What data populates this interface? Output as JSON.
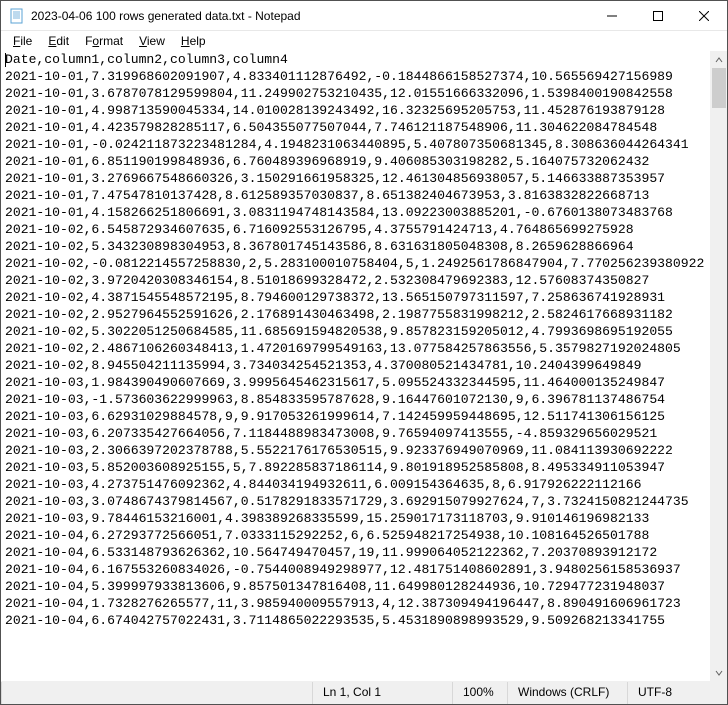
{
  "title": "2023-04-06 100 rows generated data.txt - Notepad",
  "menu": {
    "file": "File",
    "edit": "Edit",
    "format": "Format",
    "view": "View",
    "help": "Help"
  },
  "columns_header": "Date,column1,column2,column3,column4",
  "rows": [
    "2021-10-01,7.319968602091907,4.833401112876492,-0.1844866158527374,10.565569427156989",
    "2021-10-01,3.6787078129599804,11.249902753210435,12.01551666332096,1.5398400190842558",
    "2021-10-01,4.998713590045334,14.010028139243492,16.32325695205753,11.452876193879128",
    "2021-10-01,4.423579828285117,6.504355077507044,7.746121187548906,11.304622084784548",
    "2021-10-01,-0.024211873223481284,4.1948231063440895,5.407807350681345,8.308636044264341",
    "2021-10-01,6.851190199848936,6.760489396968919,9.406085303198282,5.164075732062432",
    "2021-10-01,3.2769667548660326,3.150291661958325,12.461304856938057,5.146633887353957",
    "2021-10-01,7.47547810137428,8.612589357030837,8.651382404673953,3.8163832822668713",
    "2021-10-01,4.158266251806691,3.0831194748143584,13.09223003885201,-0.6760138073483768",
    "2021-10-02,6.545872934607635,6.716092553126795,4.3755791424713,4.764865699275928",
    "2021-10-02,5.343230898304953,8.367801745143586,8.631631805048308,8.2659628866964",
    "2021-10-02,-0.0812214557258830,2,5.283100010758404,5,1.2492561786847904,7.770256239380922",
    "2021-10-02,3.9720420308346154,8.51018699328472,2.532308479692383,12.57608374350827",
    "2021-10-02,4.3871545548572195,8.794600129738372,13.565150797311597,7.258636741928931",
    "2021-10-02,2.9527964552591626,2.176891430463498,2.1987755831998212,2.5824617668931182",
    "2021-10-02,5.3022051250684585,11.685691594820538,9.857823159205012,4.7993698695192055",
    "2021-10-02,2.4867106260348413,1.4720169799549163,13.077584257863556,5.3579827192024805",
    "2021-10-02,8.945504211135994,3.734034254521353,4.370080521434781,10.2404399649849",
    "2021-10-03,1.984390490607669,3.9995645462315617,5.095524332344595,11.464000135249847",
    "2021-10-03,-1.573603622999963,8.854833595787628,9.16447601072130,9,6.396781137486754",
    "2021-10-03,6.62931029884578,9,9.917053261999614,7.142459959448695,12.511741306156125",
    "2021-10-03,6.207335427664056,7.1184488983473008,9.76594097413555,-4.859329656029521",
    "2021-10-03,2.3066397202378788,5.5522176176530515,9.923376949070969,11.084113930692222",
    "2021-10-03,5.852003608925155,5,7.892285837186114,9.801918952585808,8.495334911053947",
    "2021-10-03,4.273751476092362,4.844034194932611,6.009154364635,8,6.917926222112166",
    "2021-10-03,3.0748674379814567,0.5178291833571729,3.692915079927624,7,3.7324150821244735",
    "2021-10-03,9.78446153216001,4.398389268335599,15.259017173118703,9.910146196982133",
    "2021-10-04,6.27293772566051,7.0333115292252,6,6.525948217254938,10.108164526501788",
    "2021-10-04,6.533148793626362,10.564749470457,19,11.999064052122362,7.20370893912172",
    "2021-10-04,6.167553260834026,-0.7544008949298977,12.481751408602891,3.9480256158536937",
    "2021-10-04,5.399997933813606,9.857501347816408,11.649980128244936,10.729477231948037",
    "2021-10-04,1.7328276265577,11,3.985940009557913,4,12.387309494196447,8.890491606961723",
    "2021-10-04,6.674042757022431,3.7114865022293535,5.4531890898993529,9.509268213341755"
  ],
  "status": {
    "position": "Ln 1, Col 1",
    "zoom": "100%",
    "line_ending": "Windows (CRLF)",
    "encoding": "UTF-8"
  }
}
